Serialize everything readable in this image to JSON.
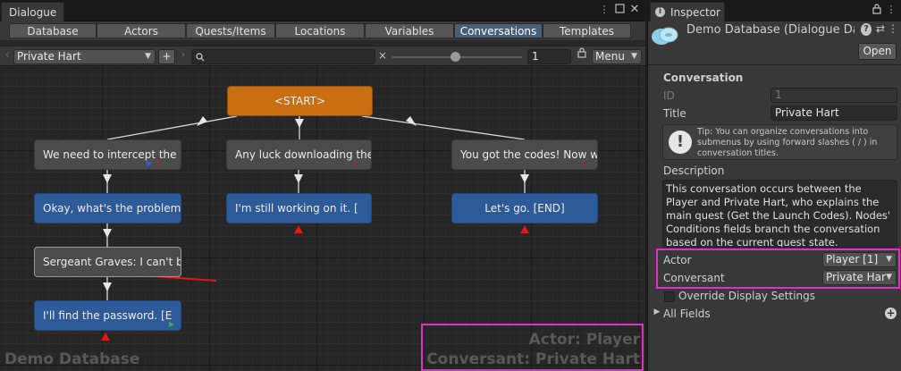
{
  "dialogue": {
    "window_tab": "Dialogue",
    "tabs": [
      "Database",
      "Actors",
      "Quests/Items",
      "Locations",
      "Variables",
      "Conversations",
      "Templates"
    ],
    "active_tab": "Conversations",
    "conversation_select": "Private Hart",
    "add_label": "+",
    "search": {
      "value": "",
      "placeholder": ""
    },
    "clear_label": "×",
    "zoom_value": "1",
    "menu_label": "Menu",
    "nodes": {
      "start": "<START>",
      "n1": "We need to intercept the l",
      "n2": "Any luck downloading the l",
      "n3": "You got the codes! Now we",
      "n4": "Okay, what's the problem?",
      "n5": "I'm still working on it. [",
      "n6": "Let's go. [END]",
      "n7": "Sergeant Graves: I can't b",
      "n8": "I'll find the password. [E"
    },
    "watermark": "Demo Database",
    "overlay_actor": "Actor: Player",
    "overlay_conversant": "Conversant: Private Hart"
  },
  "inspector": {
    "tab_label": "Inspector",
    "db_title": "Demo Database (Dialogue Dat",
    "open_label": "Open",
    "section_title": "Conversation",
    "id_label": "ID",
    "id_value": "1",
    "title_label": "Title",
    "title_value": "Private Hart",
    "tip_text": "Tip: You can organize conversations into submenus by using forward slashes ( / ) in conversation titles.",
    "description_label": "Description",
    "description_text": "This conversation occurs between the Player and Private Hart, who explains the main quest (Get the Launch Codes). Nodes' Conditions fields branch the conversation based on the current quest state.",
    "actor_label": "Actor",
    "actor_value": "Player [1]",
    "conversant_label": "Conversant",
    "conversant_value": "Private Hart",
    "override_label": "Override Display Settings",
    "all_fields_label": "All Fields"
  },
  "colors": {
    "highlight": "#e030c8",
    "active_tab": "#46607c",
    "start_node": "#c96f12",
    "npc_node": "#4b4b4b",
    "player_node": "#2d5a98",
    "arrow": "#d01010"
  }
}
